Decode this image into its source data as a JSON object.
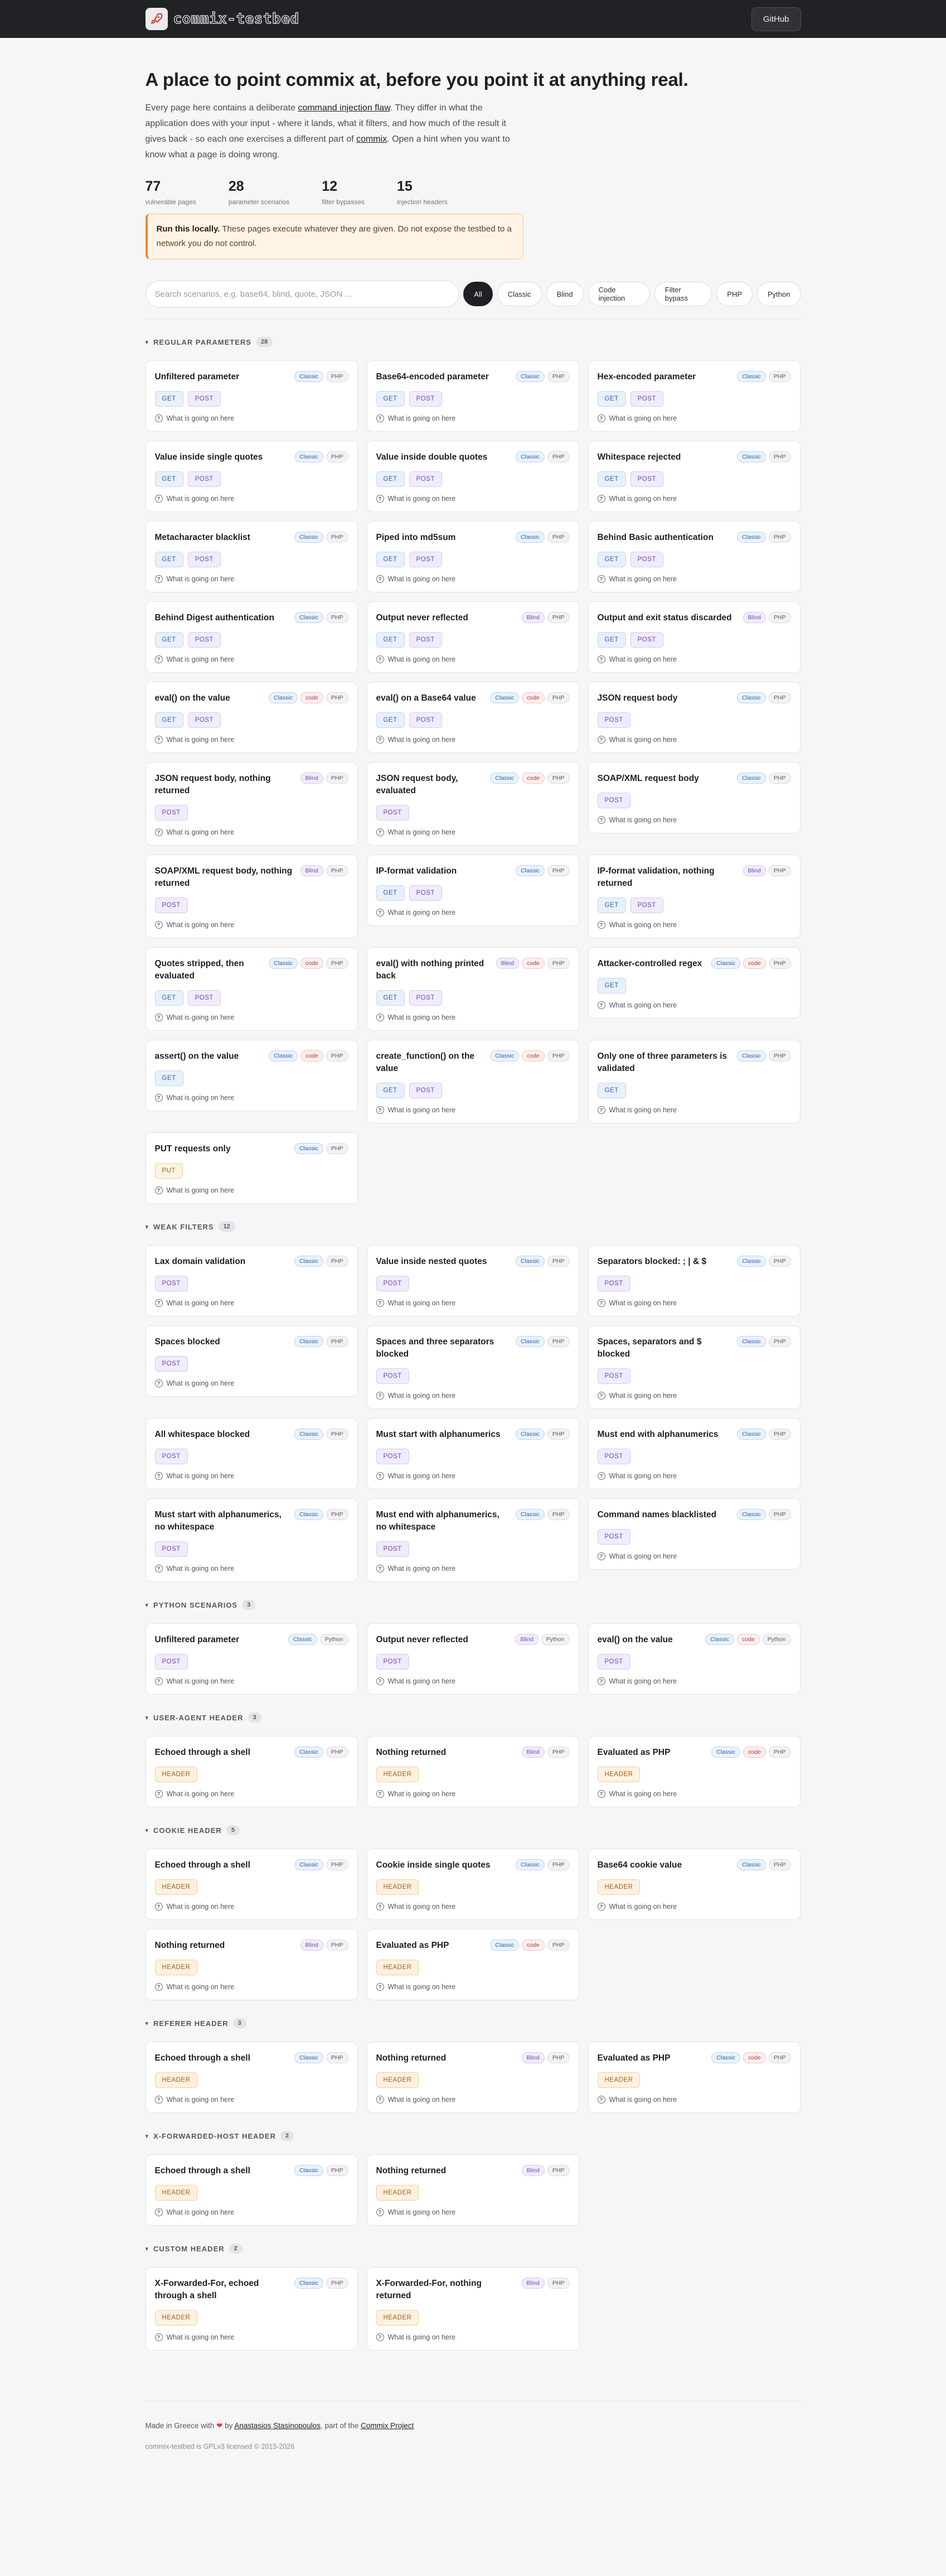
{
  "topbar": {
    "brand": "commix-testbed",
    "github_label": "GitHub"
  },
  "hero": {
    "title": "A place to point commix at, before you point it at anything real.",
    "intro_1": "Every page here contains a deliberate ",
    "intro_link_1": "command injection flaw",
    "intro_2": ". They differ in what the application does with your input - where it lands, what it filters, and how much of the result it gives back - so each one exercises a different part of ",
    "intro_link_2": "commix",
    "intro_3": ". Open a hint when you want to know what a page is doing wrong."
  },
  "stats": [
    {
      "num": "77",
      "label": "vulnerable pages"
    },
    {
      "num": "28",
      "label": "parameter scenarios"
    },
    {
      "num": "12",
      "label": "filter bypasses"
    },
    {
      "num": "15",
      "label": "injection headers"
    }
  ],
  "warning": {
    "bold": "Run this locally.",
    "text": " These pages execute whatever they are given. Do not expose the testbed to a network you do not control."
  },
  "search": {
    "placeholder": "Search scenarios, e.g. base64, blind, quote, JSON ..."
  },
  "filters": [
    "All",
    "Classic",
    "Blind",
    "Code injection",
    "Filter bypass",
    "PHP",
    "Python"
  ],
  "hint_label": "What is going on here",
  "sections": [
    {
      "title": "REGULAR PARAMETERS",
      "count": "28",
      "cards": [
        {
          "title": "Unfiltered parameter",
          "tags": [
            "Classic",
            "PHP"
          ],
          "methods": [
            "GET",
            "POST"
          ]
        },
        {
          "title": "Base64-encoded parameter",
          "tags": [
            "Classic",
            "PHP"
          ],
          "methods": [
            "GET",
            "POST"
          ]
        },
        {
          "title": "Hex-encoded parameter",
          "tags": [
            "Classic",
            "PHP"
          ],
          "methods": [
            "GET",
            "POST"
          ]
        },
        {
          "title": "Value inside single quotes",
          "tags": [
            "Classic",
            "PHP"
          ],
          "methods": [
            "GET",
            "POST"
          ]
        },
        {
          "title": "Value inside double quotes",
          "tags": [
            "Classic",
            "PHP"
          ],
          "methods": [
            "GET",
            "POST"
          ]
        },
        {
          "title": "Whitespace rejected",
          "tags": [
            "Classic",
            "PHP"
          ],
          "methods": [
            "GET",
            "POST"
          ]
        },
        {
          "title": "Metacharacter blacklist",
          "tags": [
            "Classic",
            "PHP"
          ],
          "methods": [
            "GET",
            "POST"
          ]
        },
        {
          "title": "Piped into md5sum",
          "tags": [
            "Classic",
            "PHP"
          ],
          "methods": [
            "GET",
            "POST"
          ]
        },
        {
          "title": "Behind Basic authentication",
          "tags": [
            "Classic",
            "PHP"
          ],
          "methods": [
            "GET",
            "POST"
          ]
        },
        {
          "title": "Behind Digest authentication",
          "tags": [
            "Classic",
            "PHP"
          ],
          "methods": [
            "GET",
            "POST"
          ]
        },
        {
          "title": "Output never reflected",
          "tags": [
            "Blind",
            "PHP"
          ],
          "methods": [
            "GET",
            "POST"
          ]
        },
        {
          "title": "Output and exit status discarded",
          "tags": [
            "Blind",
            "PHP"
          ],
          "methods": [
            "GET",
            "POST"
          ]
        },
        {
          "title": "eval() on the value",
          "tags": [
            "Classic",
            "code",
            "PHP"
          ],
          "methods": [
            "GET",
            "POST"
          ]
        },
        {
          "title": "eval() on a Base64 value",
          "tags": [
            "Classic",
            "code",
            "PHP"
          ],
          "methods": [
            "GET",
            "POST"
          ]
        },
        {
          "title": "JSON request body",
          "tags": [
            "Classic",
            "PHP"
          ],
          "methods": [
            "POST"
          ]
        },
        {
          "title": "JSON request body, nothing returned",
          "tags": [
            "Blind",
            "PHP"
          ],
          "methods": [
            "POST"
          ]
        },
        {
          "title": "JSON request body, evaluated",
          "tags": [
            "Classic",
            "code",
            "PHP"
          ],
          "methods": [
            "POST"
          ]
        },
        {
          "title": "SOAP/XML request body",
          "tags": [
            "Classic",
            "PHP"
          ],
          "methods": [
            "POST"
          ]
        },
        {
          "title": "SOAP/XML request body, nothing returned",
          "tags": [
            "Blind",
            "PHP"
          ],
          "methods": [
            "POST"
          ]
        },
        {
          "title": "IP-format validation",
          "tags": [
            "Classic",
            "PHP"
          ],
          "methods": [
            "GET",
            "POST"
          ]
        },
        {
          "title": "IP-format validation, nothing returned",
          "tags": [
            "Blind",
            "PHP"
          ],
          "methods": [
            "GET",
            "POST"
          ]
        },
        {
          "title": "Quotes stripped, then evaluated",
          "tags": [
            "Classic",
            "code",
            "PHP"
          ],
          "methods": [
            "GET",
            "POST"
          ]
        },
        {
          "title": "eval() with nothing printed back",
          "tags": [
            "Blind",
            "code",
            "PHP"
          ],
          "methods": [
            "GET",
            "POST"
          ]
        },
        {
          "title": "Attacker-controlled regex",
          "tags": [
            "Classic",
            "code",
            "PHP"
          ],
          "methods": [
            "GET"
          ]
        },
        {
          "title": "assert() on the value",
          "tags": [
            "Classic",
            "code",
            "PHP"
          ],
          "methods": [
            "GET"
          ]
        },
        {
          "title": "create_function() on the value",
          "tags": [
            "Classic",
            "code",
            "PHP"
          ],
          "methods": [
            "GET",
            "POST"
          ]
        },
        {
          "title": "Only one of three parameters is validated",
          "tags": [
            "Classic",
            "PHP"
          ],
          "methods": [
            "GET"
          ]
        },
        {
          "title": "PUT requests only",
          "tags": [
            "Classic",
            "PHP"
          ],
          "methods": [
            "PUT"
          ]
        }
      ]
    },
    {
      "title": "WEAK FILTERS",
      "count": "12",
      "cards": [
        {
          "title": "Lax domain validation",
          "tags": [
            "Classic",
            "PHP"
          ],
          "methods": [
            "POST"
          ]
        },
        {
          "title": "Value inside nested quotes",
          "tags": [
            "Classic",
            "PHP"
          ],
          "methods": [
            "POST"
          ]
        },
        {
          "title": "Separators blocked: ; | & $",
          "tags": [
            "Classic",
            "PHP"
          ],
          "methods": [
            "POST"
          ]
        },
        {
          "title": "Spaces blocked",
          "tags": [
            "Classic",
            "PHP"
          ],
          "methods": [
            "POST"
          ]
        },
        {
          "title": "Spaces and three separators blocked",
          "tags": [
            "Classic",
            "PHP"
          ],
          "methods": [
            "POST"
          ]
        },
        {
          "title": "Spaces, separators and $ blocked",
          "tags": [
            "Classic",
            "PHP"
          ],
          "methods": [
            "POST"
          ]
        },
        {
          "title": "All whitespace blocked",
          "tags": [
            "Classic",
            "PHP"
          ],
          "methods": [
            "POST"
          ]
        },
        {
          "title": "Must start with alphanumerics",
          "tags": [
            "Classic",
            "PHP"
          ],
          "methods": [
            "POST"
          ]
        },
        {
          "title": "Must end with alphanumerics",
          "tags": [
            "Classic",
            "PHP"
          ],
          "methods": [
            "POST"
          ]
        },
        {
          "title": "Must start with alphanumerics, no whitespace",
          "tags": [
            "Classic",
            "PHP"
          ],
          "methods": [
            "POST"
          ]
        },
        {
          "title": "Must end with alphanumerics, no whitespace",
          "tags": [
            "Classic",
            "PHP"
          ],
          "methods": [
            "POST"
          ]
        },
        {
          "title": "Command names blacklisted",
          "tags": [
            "Classic",
            "PHP"
          ],
          "methods": [
            "POST"
          ]
        }
      ]
    },
    {
      "title": "PYTHON SCENARIOS",
      "count": "3",
      "cards": [
        {
          "title": "Unfiltered parameter",
          "tags": [
            "Classic",
            "Python"
          ],
          "methods": [
            "POST"
          ]
        },
        {
          "title": "Output never reflected",
          "tags": [
            "Blind",
            "Python"
          ],
          "methods": [
            "POST"
          ]
        },
        {
          "title": "eval() on the value",
          "tags": [
            "Classic",
            "code",
            "Python"
          ],
          "methods": [
            "POST"
          ]
        }
      ]
    },
    {
      "title": "USER-AGENT HEADER",
      "count": "3",
      "cards": [
        {
          "title": "Echoed through a shell",
          "tags": [
            "Classic",
            "PHP"
          ],
          "methods": [
            "HEADER"
          ]
        },
        {
          "title": "Nothing returned",
          "tags": [
            "Blind",
            "PHP"
          ],
          "methods": [
            "HEADER"
          ]
        },
        {
          "title": "Evaluated as PHP",
          "tags": [
            "Classic",
            "code",
            "PHP"
          ],
          "methods": [
            "HEADER"
          ]
        }
      ]
    },
    {
      "title": "COOKIE HEADER",
      "count": "5",
      "cards": [
        {
          "title": "Echoed through a shell",
          "tags": [
            "Classic",
            "PHP"
          ],
          "methods": [
            "HEADER"
          ]
        },
        {
          "title": "Cookie inside single quotes",
          "tags": [
            "Classic",
            "PHP"
          ],
          "methods": [
            "HEADER"
          ]
        },
        {
          "title": "Base64 cookie value",
          "tags": [
            "Classic",
            "PHP"
          ],
          "methods": [
            "HEADER"
          ]
        },
        {
          "title": "Nothing returned",
          "tags": [
            "Blind",
            "PHP"
          ],
          "methods": [
            "HEADER"
          ]
        },
        {
          "title": "Evaluated as PHP",
          "tags": [
            "Classic",
            "code",
            "PHP"
          ],
          "methods": [
            "HEADER"
          ]
        }
      ]
    },
    {
      "title": "REFERER HEADER",
      "count": "3",
      "cards": [
        {
          "title": "Echoed through a shell",
          "tags": [
            "Classic",
            "PHP"
          ],
          "methods": [
            "HEADER"
          ]
        },
        {
          "title": "Nothing returned",
          "tags": [
            "Blind",
            "PHP"
          ],
          "methods": [
            "HEADER"
          ]
        },
        {
          "title": "Evaluated as PHP",
          "tags": [
            "Classic",
            "code",
            "PHP"
          ],
          "methods": [
            "HEADER"
          ]
        }
      ]
    },
    {
      "title": "X-FORWARDED-HOST HEADER",
      "count": "2",
      "cards": [
        {
          "title": "Echoed through a shell",
          "tags": [
            "Classic",
            "PHP"
          ],
          "methods": [
            "HEADER"
          ]
        },
        {
          "title": "Nothing returned",
          "tags": [
            "Blind",
            "PHP"
          ],
          "methods": [
            "HEADER"
          ]
        }
      ]
    },
    {
      "title": "CUSTOM HEADER",
      "count": "2",
      "cards": [
        {
          "title": "X-Forwarded-For, echoed through a shell",
          "tags": [
            "Classic",
            "PHP"
          ],
          "methods": [
            "HEADER"
          ]
        },
        {
          "title": "X-Forwarded-For, nothing returned",
          "tags": [
            "Blind",
            "PHP"
          ],
          "methods": [
            "HEADER"
          ]
        }
      ]
    }
  ],
  "footer": {
    "made_in": "Made in Greece with ",
    "by": " by ",
    "author": "Anastasios Stasinopoulos",
    "part_of": ", part of the ",
    "project": "Commix Project",
    "license": "commix-testbed is GPLv3 licensed © 2015-2026"
  },
  "colors": {
    "accent_warning": "#ef8a24",
    "topbar": "#222226",
    "classic": "#2d5fa3",
    "blind": "#6a49b8",
    "code": "#b23b3b"
  }
}
